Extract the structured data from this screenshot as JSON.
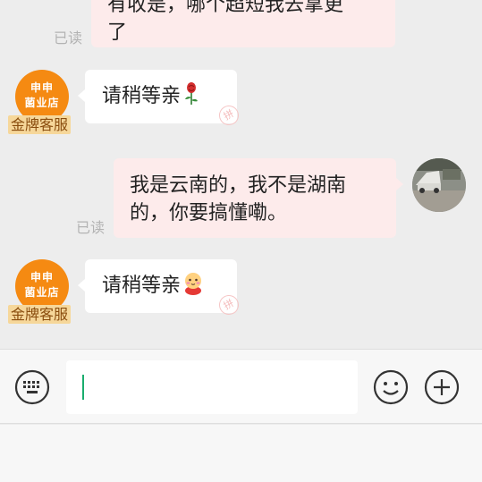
{
  "messages": [
    {
      "side": "out",
      "text_line1": "有收是，哪个超短我去拿更",
      "text_line2": "了",
      "read": "已读"
    },
    {
      "side": "in",
      "shop_name_line1": "申申",
      "shop_name_line2": "菌业店",
      "badge": "金牌客服",
      "text": "请稍等亲",
      "emoji": "rose-emoji"
    },
    {
      "side": "out",
      "text_line1": "我是云南的，我不是湖南",
      "text_line2": "的，你要搞懂嘞。",
      "read": "已读"
    },
    {
      "side": "in",
      "shop_name_line1": "申申",
      "shop_name_line2": "菌业店",
      "badge": "金牌客服",
      "text": "请稍等亲",
      "emoji": "blush-face-emoji"
    }
  ],
  "stamp_text": "拼",
  "input_bar": {
    "keyboard_icon": "keyboard-icon",
    "emoji_icon": "smiley-icon",
    "plus_icon": "plus-circle-icon",
    "input_value": ""
  },
  "colors": {
    "outgoing_bubble": "#fdebeb",
    "incoming_bubble": "#ffffff",
    "shop_avatar": "#f58a12",
    "badge_bg": "#f6d79a",
    "caret": "#1aad6e"
  }
}
